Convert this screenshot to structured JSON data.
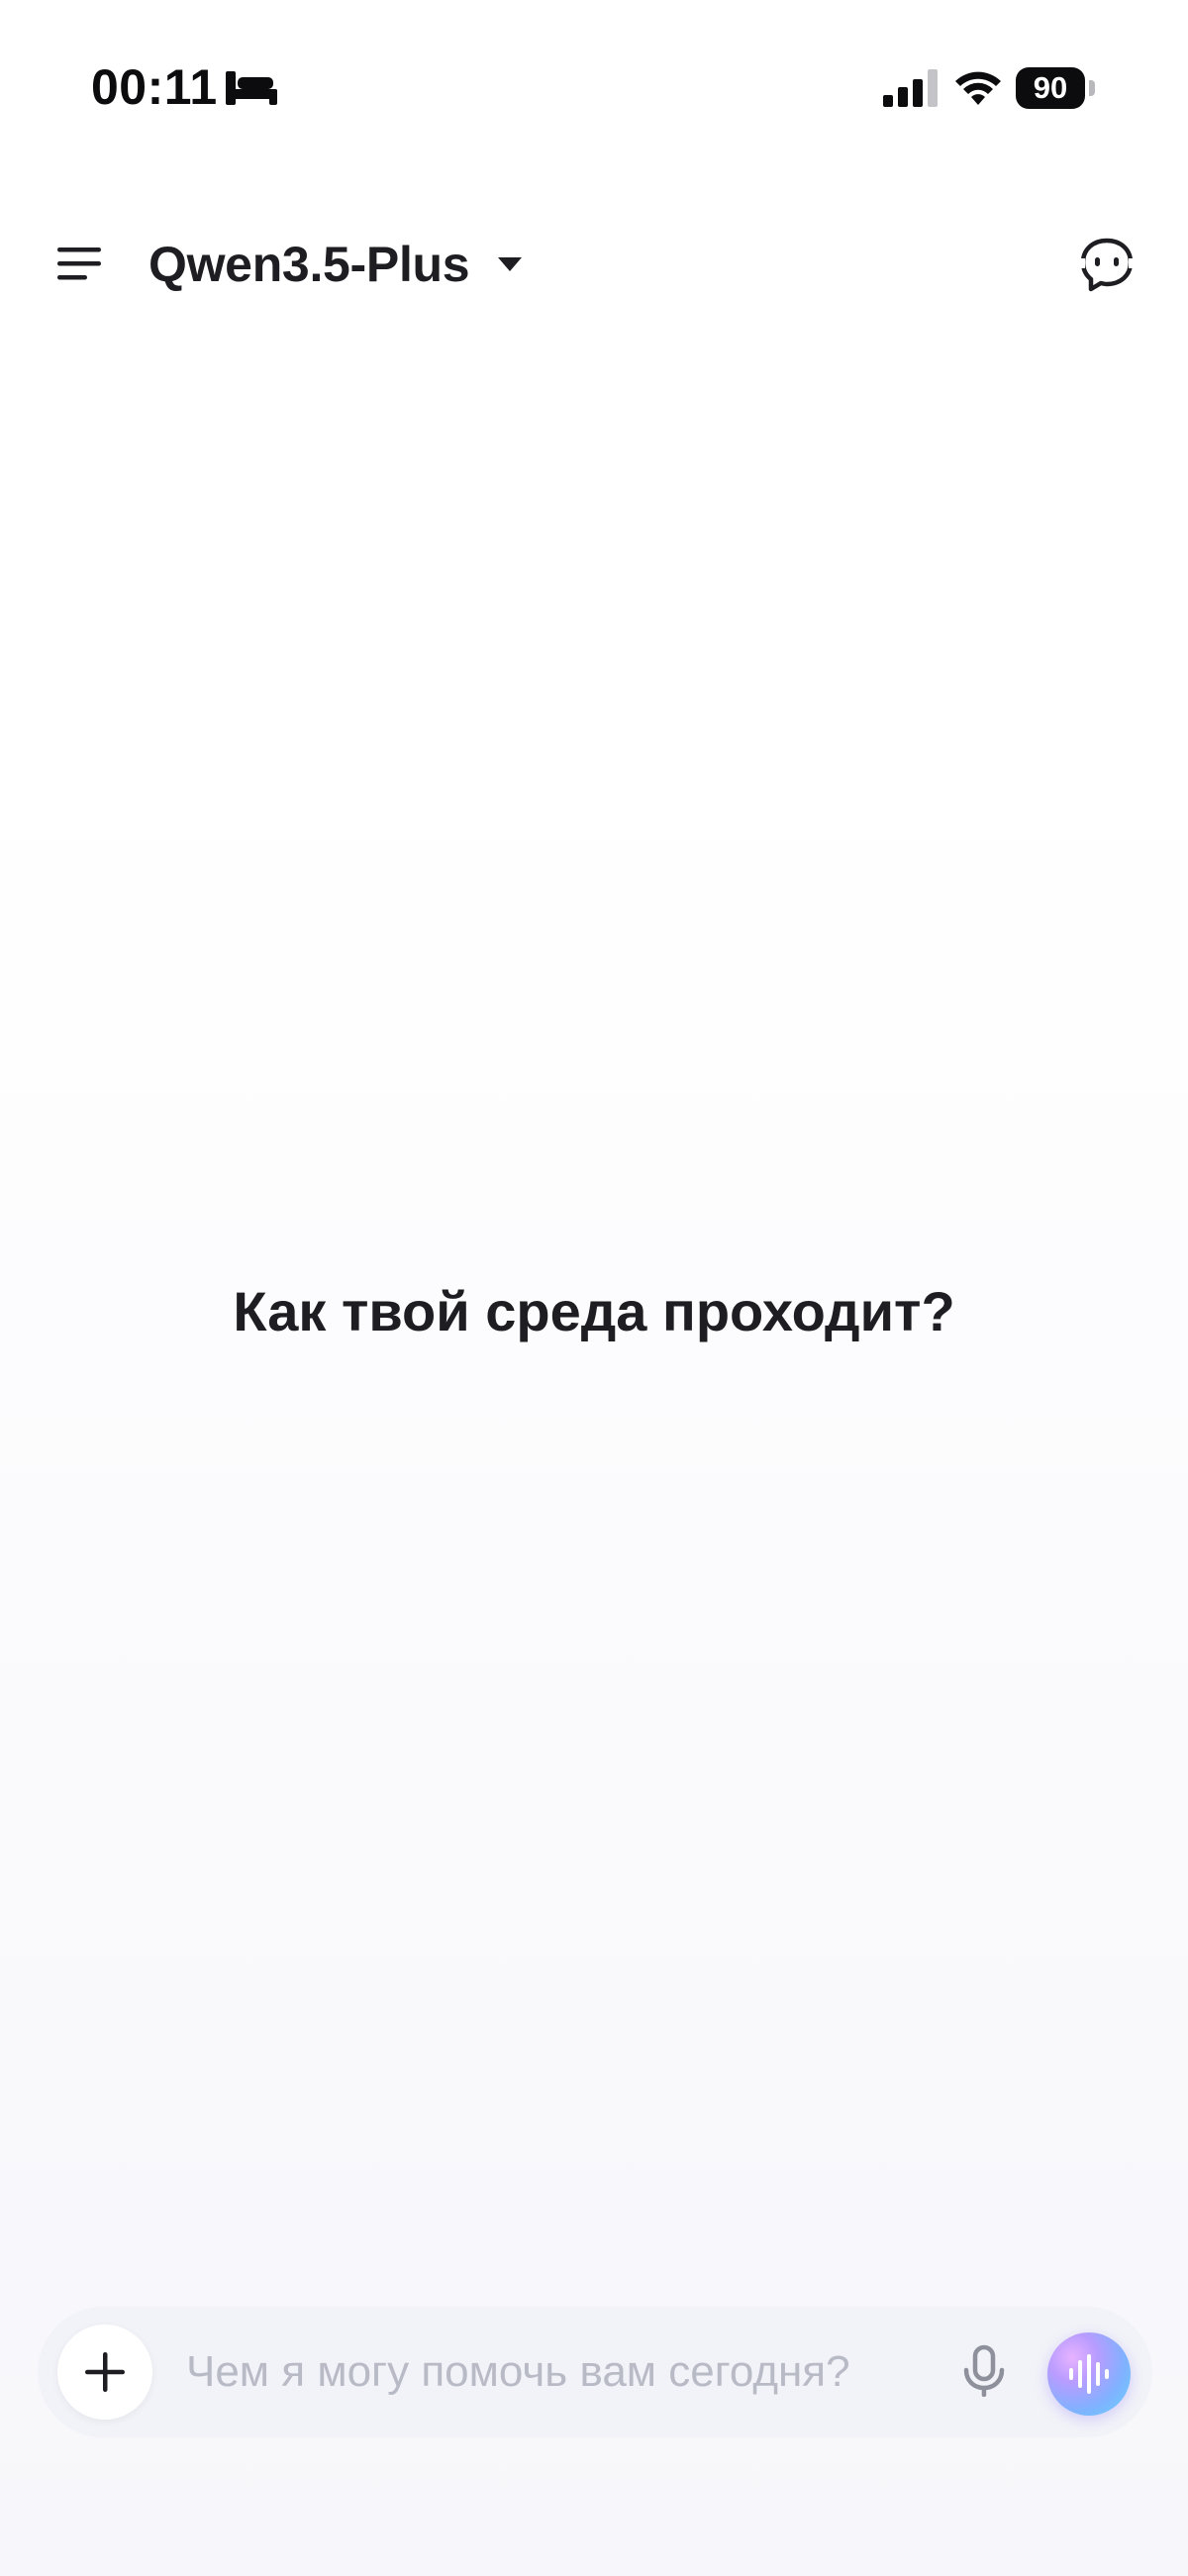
{
  "status_bar": {
    "time": "00:11",
    "battery_level": "90",
    "icons": [
      "sleep-icon",
      "cellular-signal-icon",
      "wifi-icon",
      "battery-icon"
    ]
  },
  "header": {
    "model_name": "Qwen3.5-Plus",
    "icons": [
      "menu-icon",
      "caret-down-icon",
      "new-chat-icon"
    ]
  },
  "main": {
    "greeting": "Как твой среда проходит?"
  },
  "composer": {
    "placeholder": "Чем я могу помочь вам сегодня?",
    "value": "",
    "icons": [
      "plus-icon",
      "microphone-icon",
      "voice-waveform-icon"
    ],
    "voice_button_colors": [
      "#e7b2ff",
      "#b89cff",
      "#7fb2ff",
      "#6ad4ff"
    ]
  },
  "colors": {
    "text_primary": "#1d1d22",
    "placeholder": "#b8bbc6",
    "composer_background": "#f2f3f8"
  }
}
